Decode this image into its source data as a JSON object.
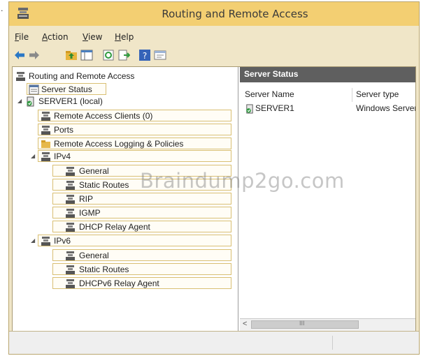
{
  "window": {
    "title": "Routing and Remote Access"
  },
  "menu": [
    {
      "label": "File",
      "accel": "F",
      "rest": "ile"
    },
    {
      "label": "Action",
      "accel": "A",
      "rest": "ction"
    },
    {
      "label": "View",
      "accel": "V",
      "rest": "iew"
    },
    {
      "label": "Help",
      "accel": "H",
      "rest": "elp"
    }
  ],
  "toolbar": [
    "back-arrow-icon",
    "forward-arrow-icon",
    "up-folder-icon",
    "console-tree-icon",
    "refresh-icon",
    "export-icon",
    "help-icon",
    "properties-icon"
  ],
  "tree": {
    "root": "Routing and Remote Access",
    "server_status": "Server Status",
    "server": "SERVER1 (local)",
    "remote_clients": "Remote Access Clients (0)",
    "ports": "Ports",
    "logging": "Remote Access Logging & Policies",
    "ipv4": "IPv4",
    "ipv4_children": [
      "General",
      "Static Routes",
      "RIP",
      "IGMP",
      "DHCP Relay Agent"
    ],
    "ipv6": "IPv6",
    "ipv6_children": [
      "General",
      "Static Routes",
      "DHCPv6 Relay Agent"
    ]
  },
  "details": {
    "header": "Server Status",
    "columns": [
      "Server Name",
      "Server type"
    ],
    "rows": [
      {
        "name": "SERVER1",
        "type": "Windows Server"
      }
    ]
  },
  "watermark": "Braindump2go.com",
  "colors": {
    "title_bar": "#f3cf72",
    "frame": "#f0e6c8",
    "pane_header": "#5f5f5f",
    "tree_highlight_border": "#d9bf73"
  }
}
